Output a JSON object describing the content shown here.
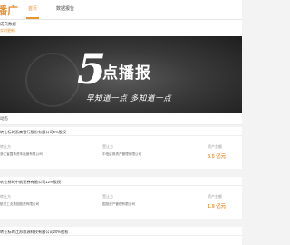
{
  "header": {
    "logo": "播广",
    "nav": [
      {
        "label": "首页",
        "active": true
      },
      {
        "label": "数据报告",
        "active": false
      }
    ]
  },
  "subhead": {
    "title": "成交数据",
    "note": "实时更新"
  },
  "banner": {
    "number": "5",
    "title": "点播报",
    "slogan": "早知道一点  多知道一点"
  },
  "section": {
    "label": "动态"
  },
  "cards": [
    {
      "title": "转让标的浙商银行股份有限公司5%股权",
      "date": "",
      "transferor_label": "转让方",
      "transferor": "浙江省国有资本运营有限公司",
      "transferee_label": "受让方",
      "transferee": "中信证券资产管理有限公司",
      "amount_label": "资产金额",
      "amount": "3.5 亿元"
    },
    {
      "title": "转让标的中航证券有限公司12%股权",
      "date": "",
      "transferor_label": "转让方",
      "transferor": "航空工业集团投资有限公司",
      "transferee_label": "受让方",
      "transferee": "国投资产管理有限公司",
      "amount_label": "资产金额",
      "amount": "1.9 亿元"
    },
    {
      "title": "转让标的江苏恩源科技有限公司20%股权",
      "date": ""
    }
  ],
  "colors": {
    "accent": "#e8953a",
    "banner_bg": "#2a2a2a"
  }
}
